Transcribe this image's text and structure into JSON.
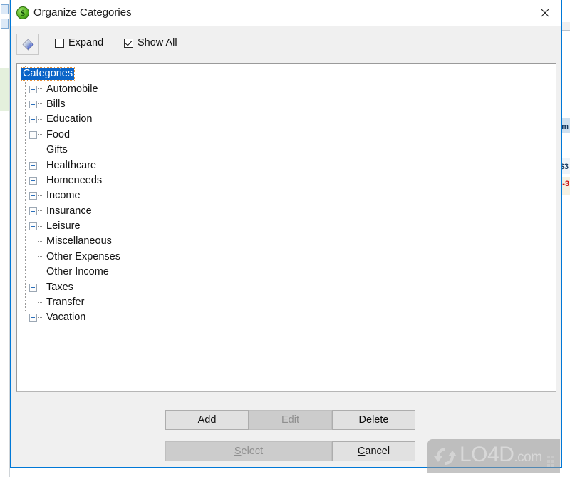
{
  "window": {
    "title": "Organize Categories",
    "app_icon": "dollar-coin-icon",
    "close_label": "✕",
    "accent_color": "#0078d7"
  },
  "toolbar": {
    "tool_button_icon": "diamond-gradient-icon",
    "checkboxes": [
      {
        "label": "Expand",
        "checked": false
      },
      {
        "label": "Show All",
        "checked": true
      }
    ]
  },
  "tree": {
    "root": {
      "label": "Categories",
      "selected": true
    },
    "items": [
      {
        "label": "Automobile",
        "expandable": true
      },
      {
        "label": "Bills",
        "expandable": true
      },
      {
        "label": "Education",
        "expandable": true
      },
      {
        "label": "Food",
        "expandable": true
      },
      {
        "label": "Gifts",
        "expandable": false
      },
      {
        "label": "Healthcare",
        "expandable": true
      },
      {
        "label": "Homeneeds",
        "expandable": true
      },
      {
        "label": "Income",
        "expandable": true
      },
      {
        "label": "Insurance",
        "expandable": true
      },
      {
        "label": "Leisure",
        "expandable": true
      },
      {
        "label": "Miscellaneous",
        "expandable": false
      },
      {
        "label": "Other Expenses",
        "expandable": false
      },
      {
        "label": "Other Income",
        "expandable": false
      },
      {
        "label": "Taxes",
        "expandable": true
      },
      {
        "label": "Transfer",
        "expandable": false
      },
      {
        "label": "Vacation",
        "expandable": true
      }
    ]
  },
  "buttons": {
    "add": {
      "label": "Add",
      "accel": "A",
      "enabled": true
    },
    "edit": {
      "label": "Edit",
      "accel": "E",
      "enabled": false
    },
    "delete": {
      "label": "Delete",
      "accel": "D",
      "enabled": true
    },
    "select": {
      "label": "Select",
      "accel": "S",
      "enabled": false
    },
    "cancel": {
      "label": "Cancel",
      "accel": "C",
      "enabled": true
    }
  },
  "background": {
    "right_window_texts": [
      "Am",
      "$3",
      "-3"
    ]
  },
  "watermark": {
    "text_main": "LO4D",
    "text_suffix": ".com",
    "logo": "refresh-arrows-icon"
  }
}
